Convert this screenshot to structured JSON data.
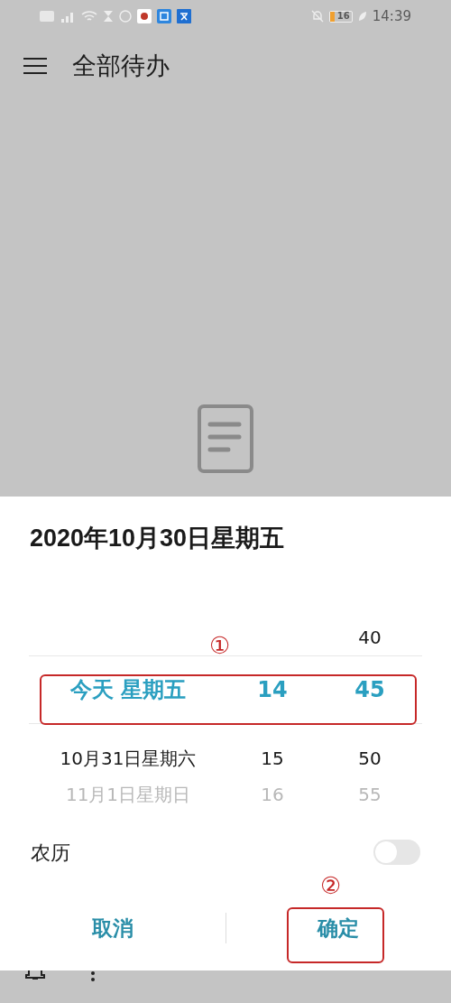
{
  "status_bar": {
    "battery": "16",
    "time": "14:39"
  },
  "header": {
    "title": "全部待办"
  },
  "dialog": {
    "title": "2020年10月30日星期五",
    "rows": [
      {
        "date": "",
        "hour": "",
        "minute": "40",
        "selected": false,
        "faded": false
      },
      {
        "date": "今天 星期五",
        "hour": "14",
        "minute": "45",
        "selected": true,
        "faded": false
      },
      {
        "date": "10月31日星期六",
        "hour": "15",
        "minute": "50",
        "selected": false,
        "faded": false
      },
      {
        "date": "11月1日星期日",
        "hour": "16",
        "minute": "55",
        "selected": false,
        "faded": true
      }
    ],
    "lunar": {
      "label": "农历",
      "on": false
    },
    "buttons": [
      "取消",
      "确定"
    ]
  },
  "annotations": [
    {
      "label": "①"
    },
    {
      "label": "②"
    }
  ]
}
